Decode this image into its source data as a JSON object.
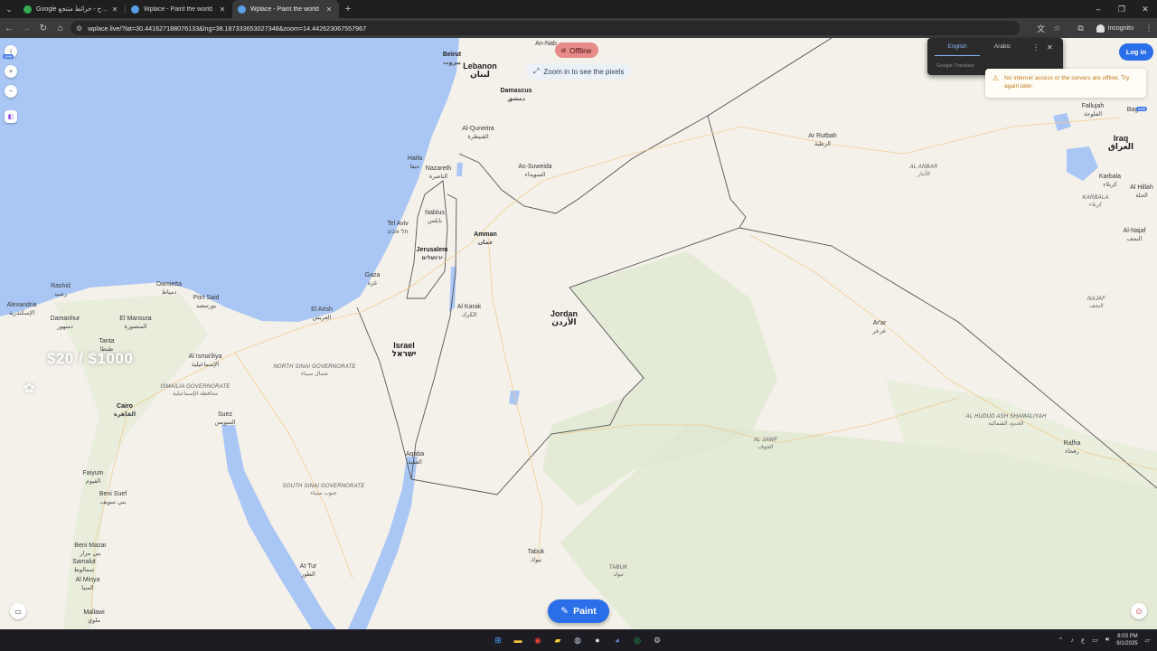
{
  "browser": {
    "tabs": [
      {
        "title": "Google ليلة كوخ - خرائط منتجع",
        "favicon_color": "#34a853",
        "active": false
      },
      {
        "title": "Wplace - Paint the world",
        "favicon_color": "#5aa0e6",
        "active": false
      },
      {
        "title": "Wplace - Paint the world",
        "favicon_color": "#5aa0e6",
        "active": true
      }
    ],
    "url": "wplace.live/?lat=30.441627188076133&lng=38.187333653027348&zoom=14.442623067557967",
    "incognito_label": "Incognito"
  },
  "translate_popup": {
    "languages": [
      "English",
      "Arabic"
    ],
    "selected": "English",
    "brand": "Google Translate"
  },
  "overlay": {
    "offline_label": "Offline",
    "zoom_hint": "Zoom in to see the pixels",
    "login_label": "Log in",
    "new_badge": "new",
    "warning": "No internet access or the servers are offline. Try again later.",
    "price": "$20 / $1000",
    "paint_label": "Paint"
  },
  "map_labels": {
    "lebanon": {
      "en": "Lebanon",
      "ar": "لبنان"
    },
    "beirut": {
      "en": "Beirut",
      "ar": "بيروت"
    },
    "damascus": {
      "en": "Damascus",
      "ar": "دمشق"
    },
    "quneitra": {
      "en": "Al-Quneitra",
      "ar": "القنيطرة"
    },
    "haifa": {
      "en": "Haifa",
      "ar": "حيفا"
    },
    "nazareth": {
      "en": "Nazareth",
      "ar": "الناصرة"
    },
    "suwayda": {
      "en": "As-Suweida",
      "ar": "السويداء"
    },
    "telaviv": {
      "en": "Tel Aviv",
      "ar": "תל אביב"
    },
    "nablus": {
      "en": "Nablus",
      "ar": "نابلس"
    },
    "amman": {
      "en": "Amman",
      "ar": "عمان"
    },
    "jerusalem": {
      "en": "Jerusalem",
      "ar": "ירושלים"
    },
    "gaza": {
      "en": "Gaza",
      "ar": "غزة"
    },
    "karak": {
      "en": "Al Karak",
      "ar": "الكرك"
    },
    "jordan": {
      "en": "Jordan",
      "ar": "الأردن"
    },
    "israel": {
      "en": "Israel",
      "ar": "ישראל"
    },
    "arish": {
      "en": "El Arish",
      "ar": "العريش"
    },
    "portsaid": {
      "en": "Port Said",
      "ar": "بورسعيد"
    },
    "damietta": {
      "en": "Damietta",
      "ar": "دمياط"
    },
    "rashid": {
      "en": "Rashid",
      "ar": "رشيد"
    },
    "alexandria": {
      "en": "Alexandria",
      "ar": "الإسكندرية"
    },
    "damanhur": {
      "en": "Damanhur",
      "ar": "دمنهور"
    },
    "mansura": {
      "en": "El Mansura",
      "ar": "المنصورة"
    },
    "tanta": {
      "en": "Tanta",
      "ar": "طنطا"
    },
    "ismailia": {
      "en": "Al Isma'iliya",
      "ar": "الإسماعيلية"
    },
    "ismailia_gov": {
      "en": "ISMAILIA GOVERNORATE",
      "ar": "محافظة الإسماعيلية"
    },
    "north_sinai": {
      "en": "NORTH SINAI GOVERNORATE",
      "ar": "شمال سيناء"
    },
    "cairo": {
      "en": "Cairo",
      "ar": "القاهرة"
    },
    "suez": {
      "en": "Suez",
      "ar": "السويس"
    },
    "faiyum": {
      "en": "Faiyum",
      "ar": "الفيوم"
    },
    "benisuef": {
      "en": "Beni Suef",
      "ar": "بني سويف"
    },
    "south_sinai": {
      "en": "SOUTH SINAI GOVERNORATE",
      "ar": "جنوب سيناء"
    },
    "aqaba": {
      "en": "Aqaba",
      "ar": "العقبة"
    },
    "benimazar": {
      "en": "Beni Mazar",
      "ar": "بني مزار"
    },
    "samalut": {
      "en": "Samalut",
      "ar": "سمالوط"
    },
    "minya": {
      "en": "Al Minya",
      "ar": "المنيا"
    },
    "mallawi": {
      "en": "Mallawi",
      "ar": "ملوي"
    },
    "attur": {
      "en": "At Tur",
      "ar": "الطور"
    },
    "tabuk": {
      "en": "Tabuk",
      "ar": "تبوك"
    },
    "tabuk_reg": {
      "en": "TABUK",
      "ar": "تبوك"
    },
    "aljawf": {
      "en": "AL JAWF",
      "ar": "الجوف"
    },
    "rutbah": {
      "en": "Ar Rutbah",
      "ar": "الرطبة"
    },
    "anbar": {
      "en": "AL ANBAR",
      "ar": "الأنبار"
    },
    "fallujah": {
      "en": "Fallujah",
      "ar": "الفلوجة"
    },
    "baghdad": {
      "en": "Bag",
      "ar": ""
    },
    "iraq": {
      "en": "Iraq",
      "ar": "العراق"
    },
    "karbala": {
      "en": "Karbala",
      "ar": "كربلاء"
    },
    "karbala_reg": {
      "en": "KARBALA",
      "ar": "كربلاء"
    },
    "hillah": {
      "en": "Al Hillah",
      "ar": "الحلة"
    },
    "najaf_city": {
      "en": "Al-Najaf",
      "ar": "النجف"
    },
    "najaf": {
      "en": "NAJAF",
      "ar": "النجف"
    },
    "arar": {
      "en": "Ar'ar",
      "ar": "عرعر"
    },
    "northern_borders": {
      "en": "AL HUDUD ASH SHAMALIYAH",
      "ar": "الحدود الشمالية"
    },
    "rafha": {
      "en": "Rafha",
      "ar": "رفحاء"
    },
    "an_nab": {
      "en": "An-Nab",
      "ar": ""
    }
  },
  "taskbar": {
    "time": "8:03 PM",
    "date": "9/1/2025",
    "lang": "ع"
  },
  "colors": {
    "water": "#a9c6f5",
    "land": "#f4f1ea",
    "accent": "#2a6fe8",
    "offline": "#e78a8a"
  }
}
